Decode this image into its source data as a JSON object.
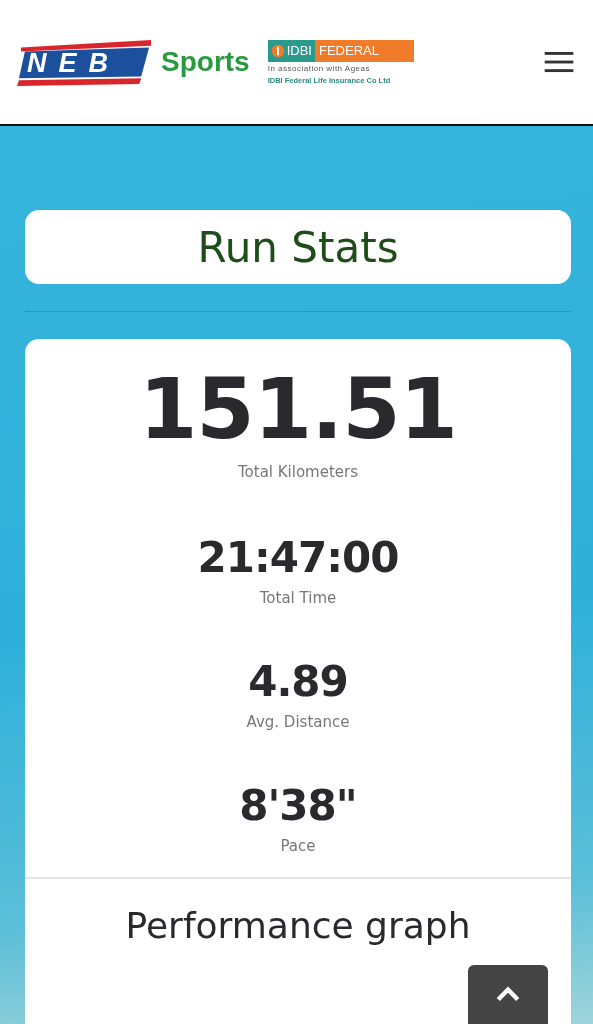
{
  "header": {
    "logo": {
      "mark": "NEB",
      "word": "Sports"
    },
    "sponsor": {
      "name_left": "IDBI",
      "name_right": "FEDERAL",
      "tagline": "In association with Ageas",
      "company": "IDBI Federal Life Insurance Co Ltd"
    }
  },
  "title": "Run Stats",
  "stats": [
    {
      "value": "151.51",
      "label": "Total Kilometers",
      "kind": "primary"
    },
    {
      "value": "21:47:00",
      "label": "Total Time",
      "kind": "secondary"
    },
    {
      "value": "4.89",
      "label": "Avg. Distance",
      "kind": "secondary"
    },
    {
      "value": "8'38\"",
      "label": "Pace",
      "kind": "secondary"
    }
  ],
  "section_title": "Performance graph"
}
